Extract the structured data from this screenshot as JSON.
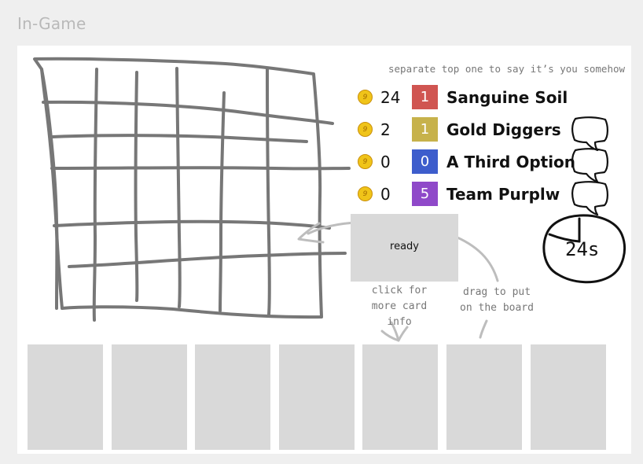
{
  "page": {
    "title": "In-Game"
  },
  "notes": {
    "top": "separate top one to say it’s you somehow",
    "click": "click for more card info",
    "drag": "drag to put on the board"
  },
  "scoreboard": [
    {
      "score": "24",
      "rank": "1",
      "team": "Sanguine Soil",
      "rank_color": "#d05551",
      "chat": false
    },
    {
      "score": "2",
      "rank": "1",
      "team": "Gold Diggers",
      "rank_color": "#c7b24b",
      "chat": true
    },
    {
      "score": "0",
      "rank": "0",
      "team": "A Third Option",
      "rank_color": "#3d5dcc",
      "chat": true
    },
    {
      "score": "0",
      "rank": "5",
      "team": "Team Purplw",
      "rank_color": "#8f49c9",
      "chat": true
    }
  ],
  "coin": {
    "icon": "coin-icon",
    "glyph": "9"
  },
  "ready": {
    "label": "ready"
  },
  "timer": {
    "label": "24s"
  },
  "colors": {
    "card_fill": "#d9d9d9",
    "sketch_stroke": "#777777"
  },
  "hand": {
    "cards": [
      "",
      "",
      "",
      "",
      "",
      "",
      ""
    ]
  }
}
